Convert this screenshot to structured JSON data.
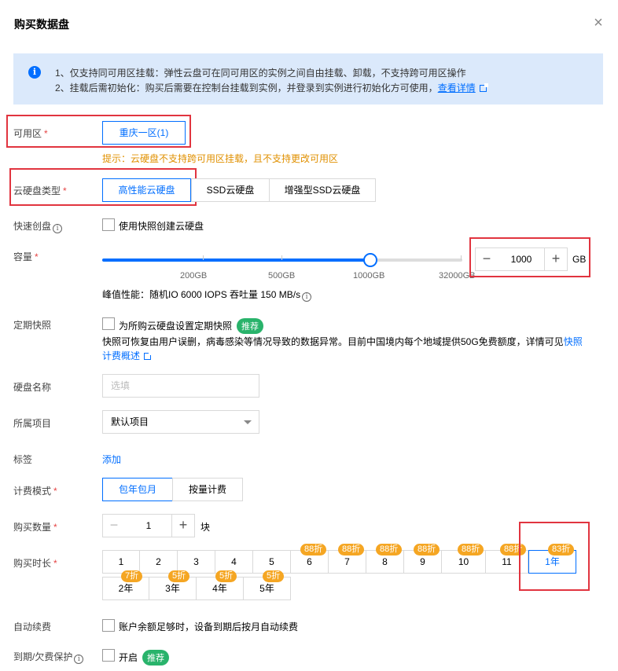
{
  "dialog": {
    "title": "购买数据盘",
    "close_glyph": "×"
  },
  "notice": {
    "icon_glyph": "i",
    "line1": "1、仅支持同可用区挂载：弹性云盘可在同可用区的实例之间自由挂载、卸载，不支持跨可用区操作",
    "line2": "2、挂载后需初始化：购买后需要在控制台挂载到实例，并登录到实例进行初始化方可使用，",
    "line2_link": "查看详情"
  },
  "zone": {
    "label": "可用区",
    "options": [
      "重庆一区(1)"
    ],
    "hint": "提示：云硬盘不支持跨可用区挂载，且不支持更改可用区"
  },
  "disk_type": {
    "label": "云硬盘类型",
    "options": [
      "高性能云硬盘",
      "SSD云硬盘",
      "增强型SSD云硬盘"
    ],
    "selected": 0
  },
  "quick_create": {
    "label": "快速创盘",
    "info_glyph": "i",
    "checkbox_label": "使用快照创建云硬盘"
  },
  "capacity": {
    "label": "容量",
    "ticks": [
      "200GB",
      "500GB",
      "1000GB",
      "32000GB"
    ],
    "value": "1000",
    "unit": "GB",
    "minus": "−",
    "plus": "+",
    "perf": "峰值性能：随机IO 6000 IOPS 吞吐量 150 MB/s",
    "perf_info_glyph": "i"
  },
  "snapshot": {
    "label": "定期快照",
    "checkbox_label": "为所购云硬盘设置定期快照",
    "badge": "推荐",
    "desc": "快照可恢复由用户误删，病毒感染等情况导致的数据异常。目前中国境内每个地域提供50G免费额度，详情可见",
    "desc_link1": "快照",
    "desc_link2": "计费概述"
  },
  "disk_name": {
    "label": "硬盘名称",
    "placeholder": "选填"
  },
  "project": {
    "label": "所属项目",
    "value": "默认项目"
  },
  "tags": {
    "label": "标签",
    "link": "添加"
  },
  "billing": {
    "label": "计费模式",
    "options": [
      "包年包月",
      "按量计费"
    ],
    "selected": 0
  },
  "quantity": {
    "label": "购买数量",
    "value": "1",
    "unit": "块",
    "minus": "−",
    "plus": "+"
  },
  "duration": {
    "label": "购买时长",
    "row1": [
      {
        "label": "1",
        "discount": ""
      },
      {
        "label": "2",
        "discount": ""
      },
      {
        "label": "3",
        "discount": ""
      },
      {
        "label": "4",
        "discount": ""
      },
      {
        "label": "5",
        "discount": ""
      },
      {
        "label": "6",
        "discount": "88折"
      },
      {
        "label": "7",
        "discount": "88折"
      },
      {
        "label": "8",
        "discount": "88折"
      },
      {
        "label": "9",
        "discount": "88折"
      },
      {
        "label": "10",
        "discount": "88折"
      },
      {
        "label": "11",
        "discount": "88折"
      },
      {
        "label": "1年",
        "discount": "83折"
      }
    ],
    "row2": [
      {
        "label": "2年",
        "discount": "7折"
      },
      {
        "label": "3年",
        "discount": "5折"
      },
      {
        "label": "4年",
        "discount": "5折"
      },
      {
        "label": "5年",
        "discount": "5折"
      }
    ],
    "selected": "1年"
  },
  "auto_renew": {
    "label": "自动续费",
    "checkbox_label": "账户余额足够时，设备到期后按月自动续费"
  },
  "protection": {
    "label": "到期/欠费保护",
    "info_glyph": "i",
    "checkbox_label": "开启",
    "badge": "推荐"
  },
  "colors": {
    "accent": "#006eff",
    "highlight_box": "#e1343f",
    "discount": "#f5a623",
    "hint": "#e09000",
    "badge_green": "#29b36b"
  }
}
